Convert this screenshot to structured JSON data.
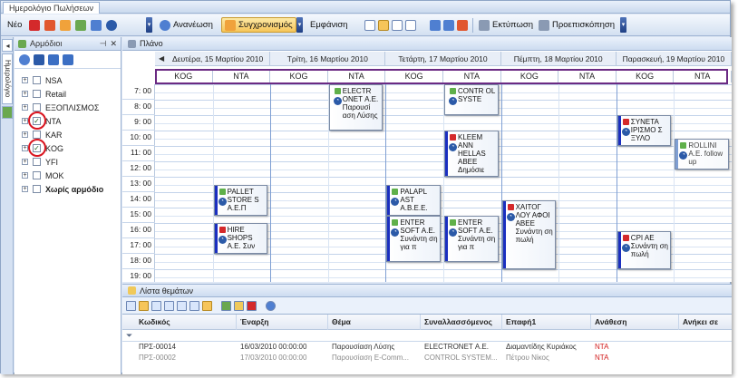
{
  "window": {
    "tab": "Ημερολόγιο Πωλήσεων"
  },
  "toolbar": {
    "new": "Νέο",
    "refresh": "Ανανέωση",
    "sync": "Συγχρονισμός",
    "view": "Εμφάνιση",
    "print": "Εκτύπωση",
    "preview": "Προεπισκόπηση"
  },
  "side_tab": "Ημερολόγιο",
  "left": {
    "title": "Αρμόδιοι",
    "items": [
      {
        "label": "NSA",
        "checked": false,
        "bold": false
      },
      {
        "label": "Retail",
        "checked": false,
        "bold": false
      },
      {
        "label": "ΕΞΟΠΛΙΣΜΟΣ",
        "checked": false,
        "bold": false
      },
      {
        "label": "NTA",
        "checked": true,
        "bold": false
      },
      {
        "label": "KAR",
        "checked": false,
        "bold": false
      },
      {
        "label": "KOG",
        "checked": true,
        "bold": false
      },
      {
        "label": "YFI",
        "checked": false,
        "bold": false
      },
      {
        "label": "MOK",
        "checked": false,
        "bold": false
      },
      {
        "label": "Χωρίς αρμόδιο",
        "checked": false,
        "bold": true
      }
    ]
  },
  "calendar": {
    "title": "Πλάνο",
    "days": [
      "Δευτέρα, 15 Μαρτίου 2010",
      "Τρίτη, 16 Μαρτίου 2010",
      "Τετάρτη, 17 Μαρτίου 2010",
      "Πέμπτη, 18 Μαρτίου 2010",
      "Παρασκευή, 19 Μαρτίου 2010"
    ],
    "resources": [
      "KOG",
      "NTA",
      "KOG",
      "NTA",
      "KOG",
      "NTA",
      "KOG",
      "NTA",
      "KOG",
      "NTA"
    ],
    "times": [
      "7: 00",
      "8: 00",
      "9: 00",
      "10: 00",
      "11: 00",
      "12: 00",
      "13: 00",
      "14: 00",
      "15: 00",
      "16: 00",
      "17: 00",
      "18: 00",
      "19: 00"
    ],
    "appointments": [
      {
        "text": "ELECTR ONET Α.Ε. Παρουσί αση Λύσης",
        "col": 3,
        "start": 7.0,
        "end": 10.0,
        "bar": "#ffffff",
        "icon": "#5fb04a",
        "dim": false
      },
      {
        "text": "CONTR OL SYSTE",
        "col": 5,
        "start": 7.0,
        "end": 9.0,
        "bar": "#ffffff",
        "icon": "#5fb04a",
        "dim": false
      },
      {
        "text": "KLEEM ANN HELLAS ABEE Δημόσιε",
        "col": 5,
        "start": 10.0,
        "end": 13.0,
        "bar": "#1a2fc0",
        "icon": "#d4292b",
        "dim": false
      },
      {
        "text": "PALLET STORE S Α.Ε.Π",
        "col": 1,
        "start": 13.5,
        "end": 15.5,
        "bar": "#1a2fc0",
        "icon": "#5fb04a",
        "dim": false
      },
      {
        "text": "HIRE SHOPS Α.Ε. Συν",
        "col": 1,
        "start": 16.0,
        "end": 18.0,
        "bar": "#1a2fc0",
        "icon": "#d4292b",
        "dim": false
      },
      {
        "text": "PALAPL AST Α.Β.Ε.Ε.",
        "col": 4,
        "start": 13.5,
        "end": 15.5,
        "bar": "#1a2fc0",
        "icon": "#5fb04a",
        "dim": false
      },
      {
        "text": "ENTER SOFT Α.Ε. Συνάντη ση για π",
        "col": 4,
        "start": 15.5,
        "end": 18.5,
        "bar": "#1a2fc0",
        "icon": "#5fb04a",
        "dim": false
      },
      {
        "text": "ENTER SOFT Α.Ε. Συνάντη ση για π",
        "col": 5,
        "start": 15.5,
        "end": 18.5,
        "bar": "#1a2fc0",
        "icon": "#5fb04a",
        "dim": false
      },
      {
        "text": "ΧΑΙΤΟΓ ΛΟΥ ΑΦΟΙ ΑΒΕΕ Συνάντη ση πωλή",
        "col": 6,
        "start": 14.5,
        "end": 19.0,
        "bar": "#1a2fc0",
        "icon": "#d4292b",
        "dim": false
      },
      {
        "text": "ΣΥΝΕΤΑ ΙΡΙΣΜΟ Σ ΞΥΛΟ",
        "col": 8,
        "start": 9.0,
        "end": 11.0,
        "bar": "#1a2fc0",
        "icon": "#d4292b",
        "dim": false
      },
      {
        "text": "ROLLINI Α.Ε. follow up",
        "col": 9,
        "start": 10.5,
        "end": 12.5,
        "bar": "#7f9fd3",
        "icon": "#5fb04a",
        "dim": true
      },
      {
        "text": "CPI AE Συνάντη ση πωλή",
        "col": 8,
        "start": 16.5,
        "end": 19.0,
        "bar": "#1a2fc0",
        "icon": "#d4292b",
        "dim": false
      }
    ]
  },
  "task_list": {
    "title": "Λίστα θεμάτων",
    "columns": [
      "Κωδικός",
      "Έναρξη",
      "Θέμα",
      "Συναλλασσόμενος",
      "Επαφή1",
      "Ανάθεση",
      "Ανήκει σε"
    ],
    "rows": [
      [
        "ΠΡΣ-00014",
        "16/03/2010 00:00:00",
        "Παρουσίαση Λύσης",
        "ELECTRONET Α.Ε.",
        "Διαμαντίδης Κυριάκος",
        "NTA",
        ""
      ],
      [
        "ΠΡΣ-00002",
        "17/03/2010 00:00:00",
        "Παρουσίαση E-Comm...",
        "CONTROL SYSTEM...",
        "Πέτρου Νίκος",
        "NTA",
        ""
      ]
    ]
  },
  "colors": {
    "accent_red": "#d9141f",
    "highlight_purple": "#6b2a83",
    "appointment_bar": "#1a2fc0"
  }
}
